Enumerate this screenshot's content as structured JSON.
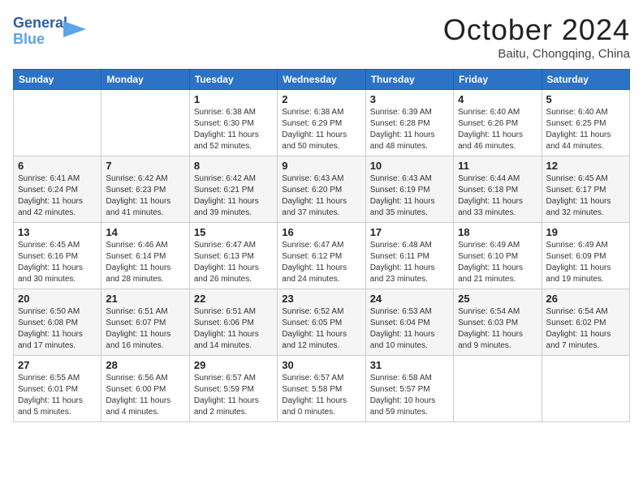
{
  "header": {
    "logo_line1": "General",
    "logo_line2": "Blue",
    "title": "October 2024",
    "subtitle": "Baitu, Chongqing, China"
  },
  "days_of_week": [
    "Sunday",
    "Monday",
    "Tuesday",
    "Wednesday",
    "Thursday",
    "Friday",
    "Saturday"
  ],
  "weeks": [
    [
      {
        "day": "",
        "info": ""
      },
      {
        "day": "",
        "info": ""
      },
      {
        "day": "1",
        "info": "Sunrise: 6:38 AM\nSunset: 6:30 PM\nDaylight: 11 hours\nand 52 minutes."
      },
      {
        "day": "2",
        "info": "Sunrise: 6:38 AM\nSunset: 6:29 PM\nDaylight: 11 hours\nand 50 minutes."
      },
      {
        "day": "3",
        "info": "Sunrise: 6:39 AM\nSunset: 6:28 PM\nDaylight: 11 hours\nand 48 minutes."
      },
      {
        "day": "4",
        "info": "Sunrise: 6:40 AM\nSunset: 6:26 PM\nDaylight: 11 hours\nand 46 minutes."
      },
      {
        "day": "5",
        "info": "Sunrise: 6:40 AM\nSunset: 6:25 PM\nDaylight: 11 hours\nand 44 minutes."
      }
    ],
    [
      {
        "day": "6",
        "info": "Sunrise: 6:41 AM\nSunset: 6:24 PM\nDaylight: 11 hours\nand 42 minutes."
      },
      {
        "day": "7",
        "info": "Sunrise: 6:42 AM\nSunset: 6:23 PM\nDaylight: 11 hours\nand 41 minutes."
      },
      {
        "day": "8",
        "info": "Sunrise: 6:42 AM\nSunset: 6:21 PM\nDaylight: 11 hours\nand 39 minutes."
      },
      {
        "day": "9",
        "info": "Sunrise: 6:43 AM\nSunset: 6:20 PM\nDaylight: 11 hours\nand 37 minutes."
      },
      {
        "day": "10",
        "info": "Sunrise: 6:43 AM\nSunset: 6:19 PM\nDaylight: 11 hours\nand 35 minutes."
      },
      {
        "day": "11",
        "info": "Sunrise: 6:44 AM\nSunset: 6:18 PM\nDaylight: 11 hours\nand 33 minutes."
      },
      {
        "day": "12",
        "info": "Sunrise: 6:45 AM\nSunset: 6:17 PM\nDaylight: 11 hours\nand 32 minutes."
      }
    ],
    [
      {
        "day": "13",
        "info": "Sunrise: 6:45 AM\nSunset: 6:16 PM\nDaylight: 11 hours\nand 30 minutes."
      },
      {
        "day": "14",
        "info": "Sunrise: 6:46 AM\nSunset: 6:14 PM\nDaylight: 11 hours\nand 28 minutes."
      },
      {
        "day": "15",
        "info": "Sunrise: 6:47 AM\nSunset: 6:13 PM\nDaylight: 11 hours\nand 26 minutes."
      },
      {
        "day": "16",
        "info": "Sunrise: 6:47 AM\nSunset: 6:12 PM\nDaylight: 11 hours\nand 24 minutes."
      },
      {
        "day": "17",
        "info": "Sunrise: 6:48 AM\nSunset: 6:11 PM\nDaylight: 11 hours\nand 23 minutes."
      },
      {
        "day": "18",
        "info": "Sunrise: 6:49 AM\nSunset: 6:10 PM\nDaylight: 11 hours\nand 21 minutes."
      },
      {
        "day": "19",
        "info": "Sunrise: 6:49 AM\nSunset: 6:09 PM\nDaylight: 11 hours\nand 19 minutes."
      }
    ],
    [
      {
        "day": "20",
        "info": "Sunrise: 6:50 AM\nSunset: 6:08 PM\nDaylight: 11 hours\nand 17 minutes."
      },
      {
        "day": "21",
        "info": "Sunrise: 6:51 AM\nSunset: 6:07 PM\nDaylight: 11 hours\nand 16 minutes."
      },
      {
        "day": "22",
        "info": "Sunrise: 6:51 AM\nSunset: 6:06 PM\nDaylight: 11 hours\nand 14 minutes."
      },
      {
        "day": "23",
        "info": "Sunrise: 6:52 AM\nSunset: 6:05 PM\nDaylight: 11 hours\nand 12 minutes."
      },
      {
        "day": "24",
        "info": "Sunrise: 6:53 AM\nSunset: 6:04 PM\nDaylight: 11 hours\nand 10 minutes."
      },
      {
        "day": "25",
        "info": "Sunrise: 6:54 AM\nSunset: 6:03 PM\nDaylight: 11 hours\nand 9 minutes."
      },
      {
        "day": "26",
        "info": "Sunrise: 6:54 AM\nSunset: 6:02 PM\nDaylight: 11 hours\nand 7 minutes."
      }
    ],
    [
      {
        "day": "27",
        "info": "Sunrise: 6:55 AM\nSunset: 6:01 PM\nDaylight: 11 hours\nand 5 minutes."
      },
      {
        "day": "28",
        "info": "Sunrise: 6:56 AM\nSunset: 6:00 PM\nDaylight: 11 hours\nand 4 minutes."
      },
      {
        "day": "29",
        "info": "Sunrise: 6:57 AM\nSunset: 5:59 PM\nDaylight: 11 hours\nand 2 minutes."
      },
      {
        "day": "30",
        "info": "Sunrise: 6:57 AM\nSunset: 5:58 PM\nDaylight: 11 hours\nand 0 minutes."
      },
      {
        "day": "31",
        "info": "Sunrise: 6:58 AM\nSunset: 5:57 PM\nDaylight: 10 hours\nand 59 minutes."
      },
      {
        "day": "",
        "info": ""
      },
      {
        "day": "",
        "info": ""
      }
    ]
  ]
}
